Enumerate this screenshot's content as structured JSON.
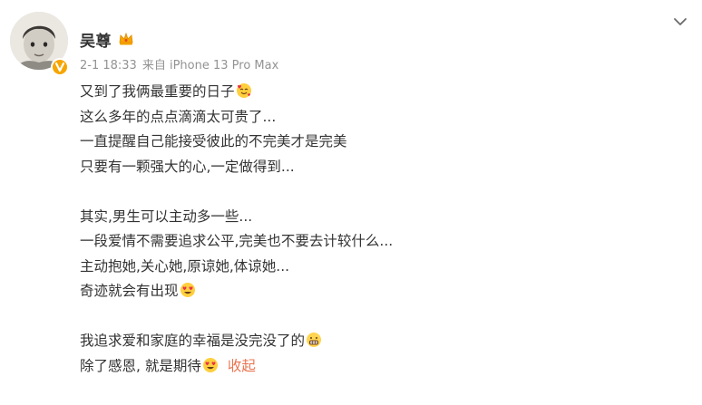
{
  "post": {
    "author": {
      "name": "吴尊"
    },
    "meta": {
      "date": "2-1 18:33",
      "source": "来自 iPhone 13 Pro Max"
    },
    "lines": [
      "又到了我俩最重要的日子",
      "这么多年的点点滴滴太可贵了...",
      "一直提醒自己能接受彼此的不完美才是完美",
      "只要有一颗强大的心,一定做得到...",
      "",
      "其实,男生可以主动多一些...",
      "一段爱情不需要追求公平,完美也不要去计较什么...",
      "主动抱她,关心她,原谅她,体谅她...",
      "奇迹就会有出现",
      "",
      "我追求爱和家庭的幸福是没完没了的",
      "除了感恩, 就是期待"
    ],
    "collapse_label": "收起"
  },
  "icons": {
    "crown": "crown-icon",
    "verified": "verified-badge-icon",
    "more": "chevron-down-icon",
    "emoji_love": "smiling-face-with-hearts-emoji",
    "emoji_heart_eyes": "heart-eyes-emoji",
    "emoji_grimace": "grimacing-emoji"
  },
  "colors": {
    "text": "#333333",
    "meta": "#939393",
    "link": "#eb7350",
    "badge": "#f7a500"
  }
}
